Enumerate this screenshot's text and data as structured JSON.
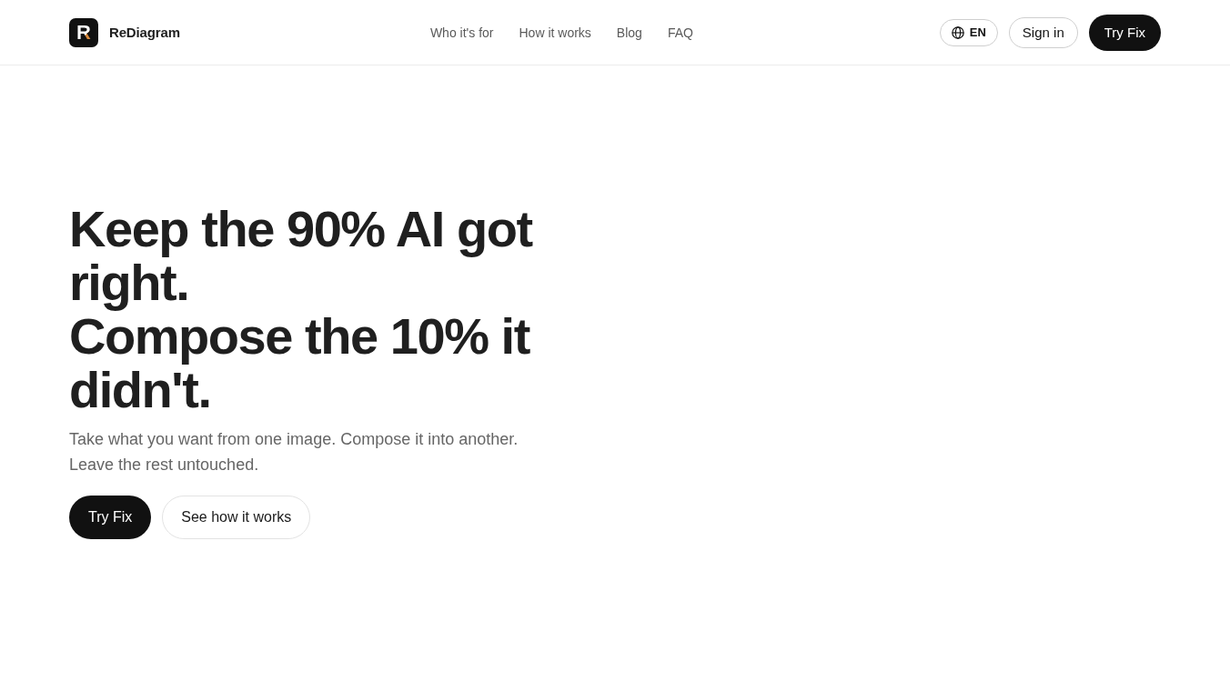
{
  "header": {
    "logo": {
      "mark": "R",
      "name": "ReDiagram"
    },
    "nav": [
      "Who it's for",
      "How it works",
      "Blog",
      "FAQ"
    ],
    "actions": [
      {
        "kind": "language",
        "label": "EN"
      },
      {
        "kind": "outline",
        "label": "Sign in"
      },
      {
        "kind": "primary",
        "label": "Try Fix"
      }
    ]
  },
  "hero": {
    "headline": [
      "Keep the 90% AI got right.",
      "Compose the 10% it didn't."
    ],
    "subtitle": "Take what you want from one image. Compose it into another. Leave the rest untouched.",
    "buttons": [
      {
        "kind": "primary",
        "label": "Try Fix"
      },
      {
        "kind": "outline",
        "label": "See how it works"
      }
    ]
  }
}
